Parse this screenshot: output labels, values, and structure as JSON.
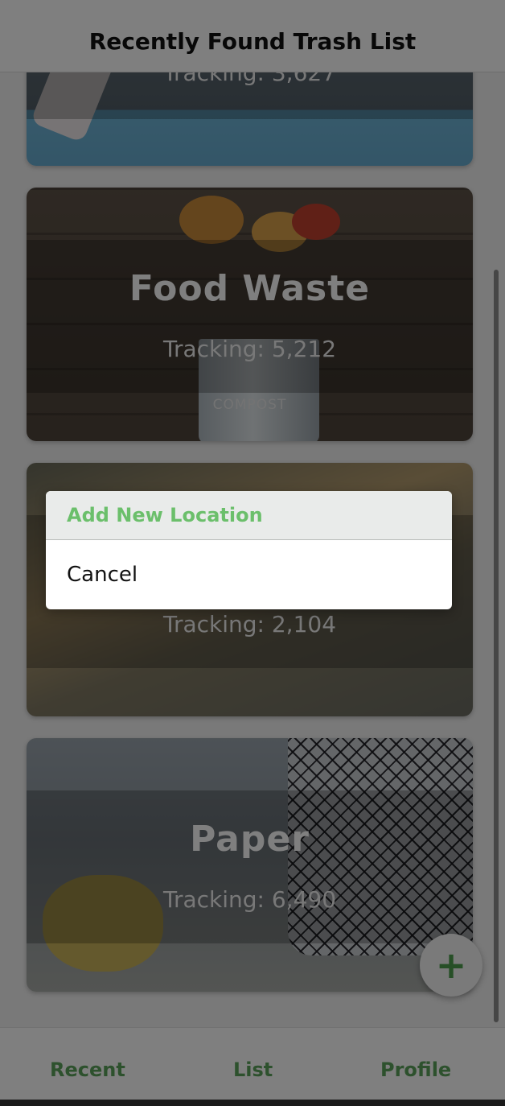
{
  "header": {
    "title": "Recently Found Trash List"
  },
  "cards": [
    {
      "title": "",
      "tracking": "Tracking: 3,627"
    },
    {
      "title": "Food Waste",
      "tracking": "Tracking: 5,212",
      "image_text": "COMPOST"
    },
    {
      "title": "",
      "tracking": "Tracking: 2,104"
    },
    {
      "title": "Paper",
      "tracking": "Tracking: 6,490"
    }
  ],
  "fab": {
    "icon": "plus-icon",
    "label": "+"
  },
  "tabs": [
    {
      "label": "Recent"
    },
    {
      "label": "List"
    },
    {
      "label": "Profile"
    }
  ],
  "dialog": {
    "primary_action": "Add New Location",
    "cancel_action": "Cancel"
  },
  "colors": {
    "accent_green": "#6bbf6b",
    "tab_green": "#5ba25b",
    "overlay": "rgba(0,0,0,0.5)"
  }
}
